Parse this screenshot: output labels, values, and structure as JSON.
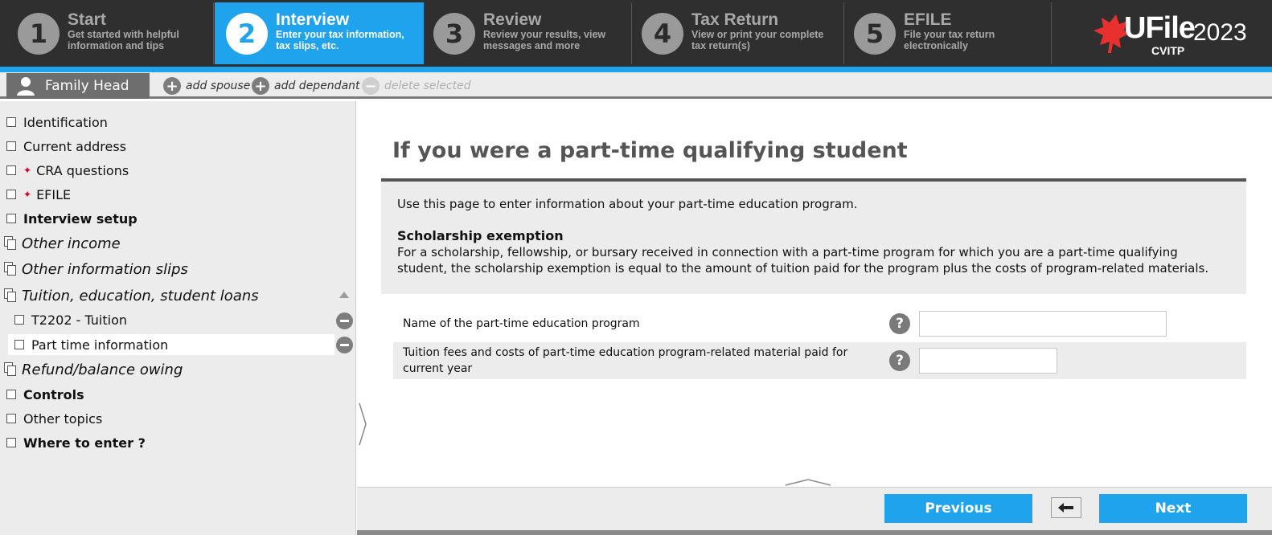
{
  "steps": [
    {
      "num": "1",
      "title": "Start",
      "sub1": "Get started with helpful",
      "sub2": "information and tips",
      "active": false
    },
    {
      "num": "2",
      "title": "Interview",
      "sub1": "Enter your tax information,",
      "sub2": "tax slips, etc.",
      "active": true
    },
    {
      "num": "3",
      "title": "Review",
      "sub1": "Review your results, view",
      "sub2": "messages and more",
      "active": false
    },
    {
      "num": "4",
      "title": "Tax Return",
      "sub1": "View or print your complete",
      "sub2": "tax return(s)",
      "active": false
    },
    {
      "num": "5",
      "title": "EFILE",
      "sub1": "File your tax return",
      "sub2": "electronically",
      "active": false
    }
  ],
  "logo": {
    "brand": "UFile",
    "year": "2023",
    "sub": "CVITP"
  },
  "family": {
    "tab_label": "Family Head",
    "add_spouse": "add spouse",
    "add_dependant": "add dependant",
    "delete_selected": "delete selected"
  },
  "sidebar": {
    "items": [
      {
        "label": "Identification"
      },
      {
        "label": "Current address"
      },
      {
        "label": "CRA questions"
      },
      {
        "label": "EFILE"
      },
      {
        "label": "Interview setup"
      },
      {
        "label": "Other income"
      },
      {
        "label": "Other information slips"
      },
      {
        "label": "Tuition, education, student loans"
      },
      {
        "label": "T2202 - Tuition"
      },
      {
        "label": "Part time information"
      },
      {
        "label": "Refund/balance owing"
      },
      {
        "label": "Controls"
      },
      {
        "label": "Other topics"
      },
      {
        "label": "Where to enter ?"
      }
    ]
  },
  "main": {
    "title": "If you were a part-time qualifying student",
    "intro": "Use this page to enter information about your part-time education program.",
    "heading": "Scholarship exemption",
    "body_line1": "For a scholarship, fellowship, or bursary received in connection with a part-time program for which you are a part-time qualifying",
    "body_line2": "student, the scholarship exemption is equal to the amount of tuition paid for the program plus the costs of program-related materials.",
    "q1_label": "Name of the part-time education program",
    "q1_value": "",
    "q2_label_line1": "Tuition fees and costs of part-time education program-related material paid for",
    "q2_label_line2": "current year",
    "q2_value": "",
    "help_glyph": "?"
  },
  "footer": {
    "previous": "Previous",
    "next": "Next"
  },
  "colors": {
    "accent": "#1ea3ec",
    "topbar": "#2f2f2f",
    "logo_red": "#e8312f"
  }
}
